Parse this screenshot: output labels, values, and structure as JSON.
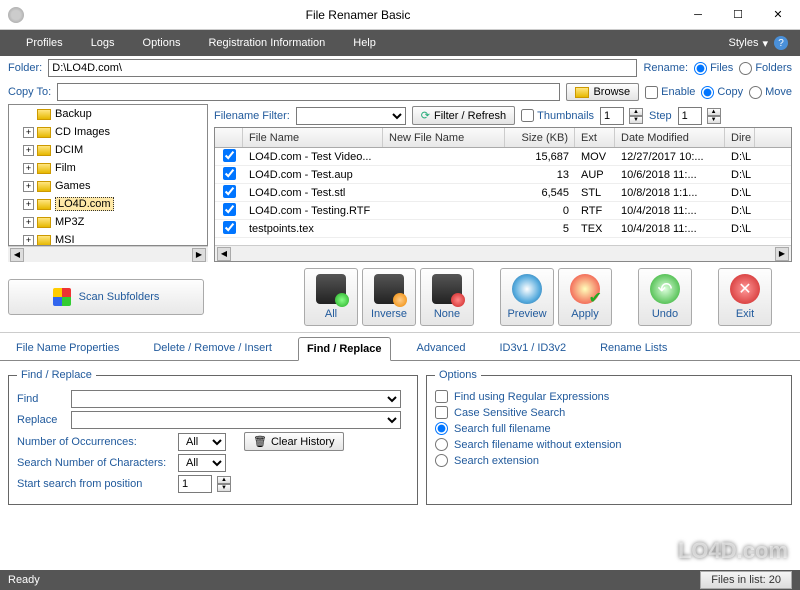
{
  "window": {
    "title": "File Renamer Basic"
  },
  "menu": {
    "profiles": "Profiles",
    "logs": "Logs",
    "options": "Options",
    "registration": "Registration Information",
    "help": "Help",
    "styles": "Styles"
  },
  "path": {
    "folder_label": "Folder:",
    "folder_value": "D:\\LO4D.com\\",
    "rename_label": "Rename:",
    "files_opt": "Files",
    "folders_opt": "Folders"
  },
  "copyto": {
    "label": "Copy To:",
    "value": "",
    "browse": "Browse",
    "enable": "Enable",
    "copy_opt": "Copy",
    "move_opt": "Move"
  },
  "filter": {
    "label": "Filename Filter:",
    "value": "",
    "refresh": "Filter / Refresh",
    "thumbnails": "Thumbnails",
    "thumb_val": "1",
    "step_label": "Step",
    "step_val": "1"
  },
  "tree": [
    {
      "name": "Backup",
      "expandable": false
    },
    {
      "name": "CD Images",
      "expandable": true
    },
    {
      "name": "DCIM",
      "expandable": true
    },
    {
      "name": "Film",
      "expandable": true
    },
    {
      "name": "Games",
      "expandable": true
    },
    {
      "name": "LO4D.com",
      "expandable": true,
      "selected": true
    },
    {
      "name": "MP3Z",
      "expandable": true
    },
    {
      "name": "MSI",
      "expandable": true
    }
  ],
  "grid": {
    "headers": {
      "chk": "",
      "name": "File Name",
      "newname": "New File Name",
      "size": "Size (KB)",
      "ext": "Ext",
      "date": "Date Modified",
      "dir": "Dire"
    },
    "rows": [
      {
        "checked": true,
        "name": "LO4D.com - Test Video...",
        "newname": "",
        "size": "15,687",
        "ext": "MOV",
        "date": "12/27/2017 10:...",
        "dir": "D:\\L"
      },
      {
        "checked": true,
        "name": "LO4D.com - Test.aup",
        "newname": "",
        "size": "13",
        "ext": "AUP",
        "date": "10/6/2018 11:...",
        "dir": "D:\\L"
      },
      {
        "checked": true,
        "name": "LO4D.com - Test.stl",
        "newname": "",
        "size": "6,545",
        "ext": "STL",
        "date": "10/8/2018 1:1...",
        "dir": "D:\\L"
      },
      {
        "checked": true,
        "name": "LO4D.com - Testing.RTF",
        "newname": "",
        "size": "0",
        "ext": "RTF",
        "date": "10/4/2018 11:...",
        "dir": "D:\\L"
      },
      {
        "checked": true,
        "name": "testpoints.tex",
        "newname": "",
        "size": "5",
        "ext": "TEX",
        "date": "10/4/2018 11:...",
        "dir": "D:\\L"
      }
    ]
  },
  "scan": "Scan Subfolders",
  "bigbtn": {
    "all": "All",
    "inverse": "Inverse",
    "none": "None",
    "preview": "Preview",
    "apply": "Apply",
    "undo": "Undo",
    "exit": "Exit"
  },
  "tabs": {
    "props": "File Name Properties",
    "delete": "Delete / Remove / Insert",
    "find": "Find / Replace",
    "advanced": "Advanced",
    "id3": "ID3v1 / ID3v2",
    "lists": "Rename Lists"
  },
  "find": {
    "legend": "Find / Replace",
    "find_label": "Find",
    "replace_label": "Replace",
    "find_val": "",
    "replace_val": "",
    "occ_label": "Number of Occurrences:",
    "occ_val": "All",
    "chars_label": "Search Number of Characters:",
    "chars_val": "All",
    "pos_label": "Start search from position",
    "pos_val": "1",
    "clear": "Clear History"
  },
  "options": {
    "legend": "Options",
    "regex": "Find using Regular Expressions",
    "case": "Case Sensitive Search",
    "full": "Search full filename",
    "noext": "Search filename without extension",
    "ext": "Search extension"
  },
  "status": {
    "ready": "Ready",
    "count": "Files in list: 20"
  },
  "watermark": "LO4D.com"
}
